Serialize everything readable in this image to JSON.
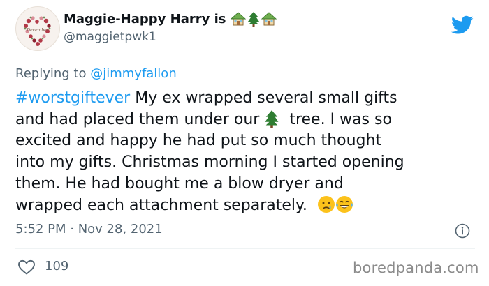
{
  "author": {
    "display_name": "Maggie-Happy Harry is",
    "name_emojis": [
      "house-icon",
      "christmas-tree-icon",
      "house-icon"
    ],
    "handle": "@maggietpwk1",
    "avatar": "heart-wreath-avatar"
  },
  "reply": {
    "prefix": "Replying to",
    "mention": "@jimmyfallon"
  },
  "body": {
    "hashtag": "#worstgiftever",
    "line1_rest": " My ex wrapped several small gifts",
    "line2a": "and had placed them under our",
    "line2b": "tree. I was so",
    "line3": "excited and happy he had put so much thought",
    "line4": "into my gifts.  Christmas morning I started opening",
    "line5": "them. He had bought me a blow dryer and",
    "line6": "wrapped each attachment separately.",
    "end_emojis": [
      "crying-face-icon",
      "tears-of-joy-icon"
    ]
  },
  "meta": {
    "time": "5:52 PM",
    "separator": " · ",
    "date": "Nov 28, 2021"
  },
  "actions": {
    "likes": "109"
  },
  "watermark": "boredpanda.com",
  "colors": {
    "link": "#1d9bf0",
    "secondary": "#536471",
    "text": "#0f1419",
    "like_icon": "#536471"
  }
}
